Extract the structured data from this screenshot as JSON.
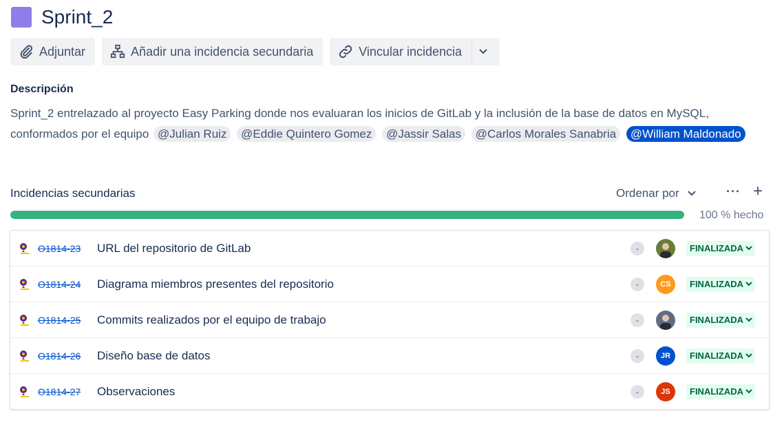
{
  "issue": {
    "title": "Sprint_2",
    "epic_color": "#8f7ee7"
  },
  "toolbar": {
    "attach_label": "Adjuntar",
    "add_child_label": "Añadir una incidencia secundaria",
    "link_label": "Vincular incidencia"
  },
  "description": {
    "label": "Descripción",
    "text_line1": "Sprint_2 entrelazado al proyecto Easy Parking donde nos evaluaran los inicios de GitLab y la inclusión de la base de datos en MySQL,",
    "text_line2": "conformados por el equipo",
    "mentions": [
      "@Julian Ruiz",
      "@Eddie Quintero Gomez",
      "@Jassir Salas",
      "@Carlos Morales Sanabria",
      "@William Maldonado"
    ]
  },
  "child_issues": {
    "label": "Incidencias secundarias",
    "sort_label": "Ordenar por",
    "progress_percent": 100,
    "progress_text": "100 % hecho",
    "items": [
      {
        "key": "O1814-23",
        "summary": "URL del repositorio de GitLab",
        "priority": "-",
        "assignee_initials": "",
        "assignee_color": "#6a7b3a",
        "status": "FINALIZADA"
      },
      {
        "key": "O1814-24",
        "summary": "Diagrama miembros presentes del repositorio",
        "priority": "-",
        "assignee_initials": "CS",
        "assignee_color": "#ff991f",
        "status": "FINALIZADA"
      },
      {
        "key": "O1814-25",
        "summary": "Commits realizados por el equipo de trabajo",
        "priority": "-",
        "assignee_initials": "",
        "assignee_color": "#5e6c84",
        "status": "FINALIZADA"
      },
      {
        "key": "O1814-26",
        "summary": "Diseño base de datos",
        "priority": "-",
        "assignee_initials": "JR",
        "assignee_color": "#0052cc",
        "status": "FINALIZADA"
      },
      {
        "key": "O1814-27",
        "summary": "Observaciones",
        "priority": "-",
        "assignee_initials": "JS",
        "assignee_color": "#de350b",
        "status": "FINALIZADA"
      }
    ]
  }
}
